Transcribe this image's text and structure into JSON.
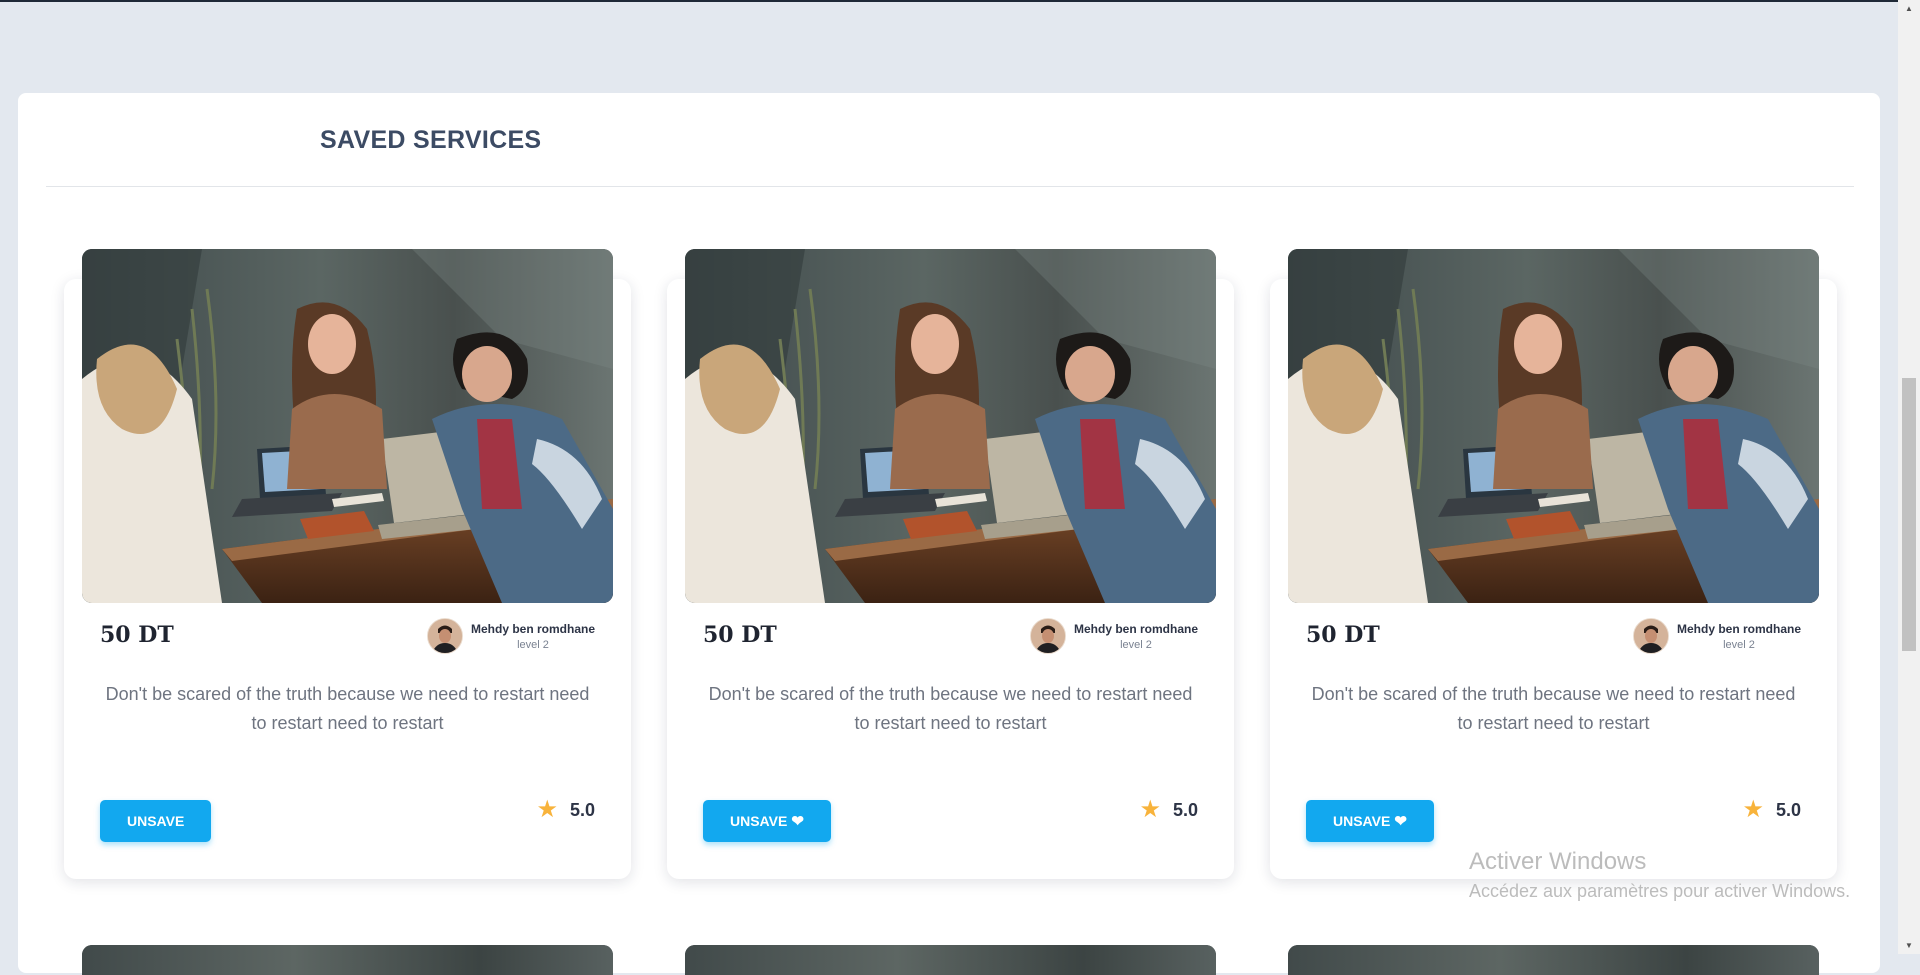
{
  "section": {
    "title": "SAVED SERVICES"
  },
  "cards": [
    {
      "price": "50 DT",
      "seller_name": "Mehdy ben romdhane",
      "seller_level": "level 2",
      "description": "Don't be scared of the truth because we need to restart need to restart need to restart",
      "button_label": "UNSAVE",
      "show_heart": false,
      "rating": "5.0"
    },
    {
      "price": "50 DT",
      "seller_name": "Mehdy ben romdhane",
      "seller_level": "level 2",
      "description": "Don't be scared of the truth because we need to restart need to restart need to restart",
      "button_label": "UNSAVE",
      "show_heart": true,
      "rating": "5.0"
    },
    {
      "price": "50 DT",
      "seller_name": "Mehdy ben romdhane",
      "seller_level": "level 2",
      "description": "Don't be scared of the truth because we need to restart need to restart need to restart",
      "button_label": "UNSAVE",
      "show_heart": true,
      "rating": "5.0"
    }
  ],
  "icons": {
    "heart": "heart-icon",
    "star": "star-icon",
    "avatar": "avatar"
  },
  "colors": {
    "button": "#12a8ef",
    "star": "#f8b33b",
    "title": "#3c4b64",
    "background": "#e3e8ef"
  },
  "watermark": {
    "title": "Activer Windows",
    "subtitle": "Accédez aux paramètres pour activer Windows."
  }
}
